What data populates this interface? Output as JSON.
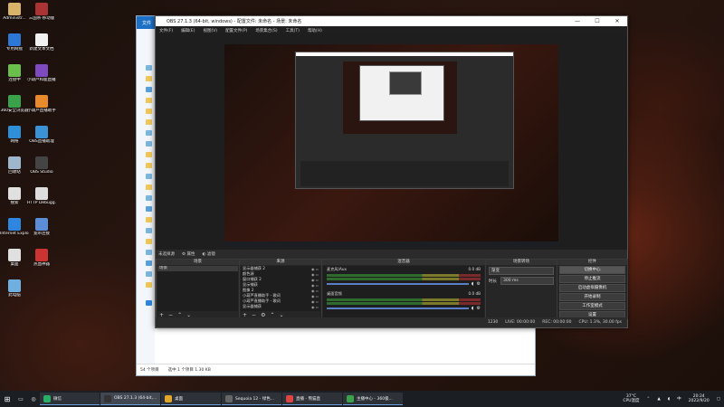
{
  "desktop": {
    "calligraphy": "",
    "icons": [
      {
        "label": "Administr...",
        "color": "#d9b36a"
      },
      {
        "label": "三国杀·移动版",
        "color": "#a33"
      },
      {
        "label": "专用网盘",
        "color": "#2d77d6"
      },
      {
        "label": "新建文本文档",
        "color": "#f1f1f1"
      },
      {
        "label": "连接中",
        "color": "#6bbf4b"
      },
      {
        "label": "小葫芦和鹿直播助手 4.2",
        "color": "#7d4bbf"
      },
      {
        "label": "360安全浏览器",
        "color": "#3aa24a"
      },
      {
        "label": "小葫芦直播助手",
        "color": "#e98a2c"
      },
      {
        "label": "网络",
        "color": "#2f8fd8"
      },
      {
        "label": "OBS直播助理",
        "color": "#3b92d4"
      },
      {
        "label": "回收站",
        "color": "#9fb7cc"
      },
      {
        "label": "OBS Studio",
        "color": "#444"
      },
      {
        "label": "搜索",
        "color": "#e0e0e0"
      },
      {
        "label": "HTTP Debugg...",
        "color": "#ddd"
      },
      {
        "label": "Internet Explorer",
        "color": "#2e86de"
      },
      {
        "label": "宽带连接",
        "color": "#5b8ed6"
      },
      {
        "label": "桌面",
        "color": "#e0e0e0"
      },
      {
        "label": "热血神器",
        "color": "#c33"
      },
      {
        "label": "此电脑",
        "color": "#6fb0e0"
      }
    ]
  },
  "explorer": {
    "ribbon_tab": "文件",
    "status_items": "54 个项目",
    "status_selected": "选中 1 个项目  1.30 KB"
  },
  "obs": {
    "title": "OBS 27.1.3 (64-bit, windows) - 配置文件: 未命名 - 场景: 未命名",
    "menu": [
      "文件(F)",
      "编辑(E)",
      "视图(V)",
      "配置文件(P)",
      "场景集合(S)",
      "工具(T)",
      "帮助(H)"
    ],
    "scene_bar": {
      "label": "未选择源",
      "properties": "属性",
      "filters": "滤镜"
    },
    "docks": {
      "scenes": {
        "title": "场景",
        "items": [
          "场景"
        ]
      },
      "sources": {
        "title": "来源",
        "items": [
          "显示器捕获 2",
          "颜色源",
          "窗口捕获 2",
          "显示捕获",
          "图像 2",
          "小葫芦直播助手 - 歌词",
          "小葫芦直播助手 - 歌词",
          "显示器捕获"
        ]
      },
      "mixer": {
        "title": "混音器",
        "channels": [
          {
            "name": "麦克风/Aux",
            "db": "0.0 dB"
          },
          {
            "name": "桌面音频",
            "db": "0.0 dB"
          }
        ]
      },
      "transitions": {
        "title": "场景转场",
        "type": "渐变",
        "duration_label": "时长",
        "duration": "300 ms"
      },
      "controls": {
        "title": "控件",
        "buttons": [
          "切换中心",
          "停止推流",
          "启动虚拟摄像机",
          "开始录制",
          "工作室模式",
          "设置",
          "退出"
        ]
      }
    },
    "status": {
      "live": "LIVE: 00:00:00",
      "rec": "REC: 00:00:00",
      "cpu": "CPU: 1.3%, 30.00 fps",
      "dropped": "1230"
    }
  },
  "taskbar": {
    "tasks": [
      {
        "label": "微信",
        "color": "#2aae67"
      },
      {
        "label": "OBS 27.1.3 (64-bit,...",
        "color": "#333"
      },
      {
        "label": "桌面",
        "color": "#e0a62a"
      },
      {
        "label": "Sequoia 12 - 绿色...",
        "color": "#666"
      },
      {
        "label": "直播 - 熊猫直",
        "color": "#d44"
      },
      {
        "label": "主播中心 - 360极...",
        "color": "#3aa24a"
      }
    ],
    "temp": "37°C",
    "temp_label": "CPU温度",
    "time": "20:24",
    "date": "2022/9/20"
  },
  "colors": {
    "accent": "#6aa0e0",
    "obs_bg": "#2b2b2b"
  }
}
